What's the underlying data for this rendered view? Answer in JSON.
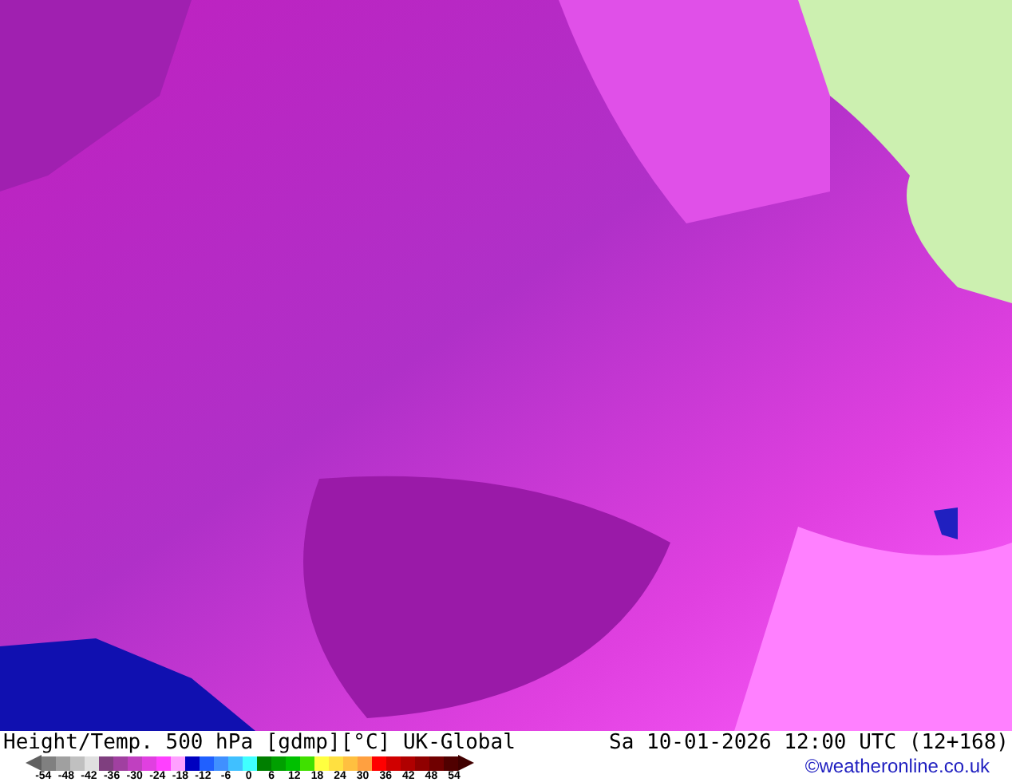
{
  "map": {
    "title": "Height/Temp. 500 hPa [gdmp][°C] UK-Global",
    "valid_time": "Sa 10-01-2026 12:00 UTC (12+168)"
  },
  "legend": {
    "segments": [
      {
        "color": "#808080"
      },
      {
        "color": "#a0a0a0"
      },
      {
        "color": "#c0c0c0"
      },
      {
        "color": "#e0e0e0"
      },
      {
        "color": "#7f3f7f"
      },
      {
        "color": "#a040a0"
      },
      {
        "color": "#c040c0"
      },
      {
        "color": "#e040e0"
      },
      {
        "color": "#ff40ff"
      },
      {
        "color": "#ffa0ff"
      },
      {
        "color": "#0000c0"
      },
      {
        "color": "#2060ff"
      },
      {
        "color": "#4090ff"
      },
      {
        "color": "#40c0ff"
      },
      {
        "color": "#40ffff"
      },
      {
        "color": "#007f00"
      },
      {
        "color": "#00a000"
      },
      {
        "color": "#00c000"
      },
      {
        "color": "#40e000"
      },
      {
        "color": "#ffff40"
      },
      {
        "color": "#ffe040"
      },
      {
        "color": "#ffc040"
      },
      {
        "color": "#ffa040"
      },
      {
        "color": "#ff0000"
      },
      {
        "color": "#d00000"
      },
      {
        "color": "#b00000"
      },
      {
        "color": "#900000"
      },
      {
        "color": "#700000"
      },
      {
        "color": "#500000"
      }
    ],
    "labels": [
      "-54",
      "-48",
      "-42",
      "-36",
      "-30",
      "-24",
      "-18",
      "-12",
      "-6",
      "0",
      "6",
      "12",
      "18",
      "24",
      "30",
      "36",
      "42",
      "48",
      "54"
    ]
  },
  "credit": "©weatheronline.co.uk"
}
